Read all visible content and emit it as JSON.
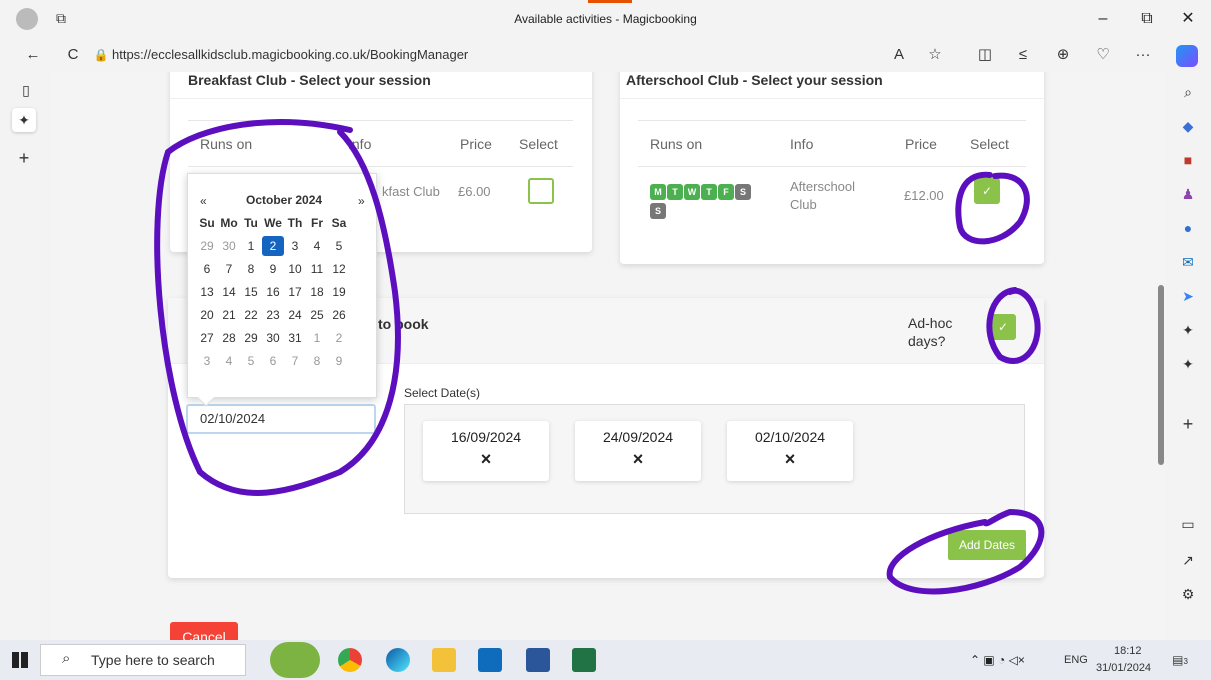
{
  "window": {
    "title": "Available activities - Magicbooking",
    "minimize": "–",
    "maximize": "⧉",
    "close": "✕"
  },
  "browser": {
    "url": "https://ecclesallkidsclub.magicbooking.co.uk/BookingManager",
    "back": "←",
    "refresh": "C",
    "read_aloud": "A",
    "more": "···"
  },
  "breakfast": {
    "title": "Breakfast Club - Select your session",
    "headers": {
      "runs_on": "Runs on",
      "info": "Info",
      "price": "Price",
      "select": "Select"
    },
    "row": {
      "info": "kfast Club",
      "price": "£6.00"
    }
  },
  "afterschool": {
    "title": "Afterschool Club - Select your session",
    "headers": {
      "runs_on": "Runs on",
      "info": "Info",
      "price": "Price",
      "select": "Select"
    },
    "days": [
      "M",
      "T",
      "W",
      "T",
      "F",
      "S",
      "S"
    ],
    "row": {
      "info": "Afterschool Club",
      "price": "£12.00",
      "check": "✓"
    }
  },
  "dates_card": {
    "title_fragment": "to book",
    "adhoc_label": "Ad-hoc days?",
    "adhoc_check": "✓",
    "select_dates_label": "Select Date(s)",
    "date_input_value": "02/10/2024",
    "selected_dates": [
      {
        "date": "16/09/2024",
        "remove": "×"
      },
      {
        "date": "24/09/2024",
        "remove": "×"
      },
      {
        "date": "02/10/2024",
        "remove": "×"
      }
    ],
    "add_dates_button": "Add Dates",
    "cancel_button": "Cancel"
  },
  "calendar": {
    "prev": "«",
    "month": "October 2024",
    "next": "»",
    "weekdays": [
      "Su",
      "Mo",
      "Tu",
      "We",
      "Th",
      "Fr",
      "Sa"
    ],
    "weeks": [
      [
        "29",
        "30",
        "1",
        "2",
        "3",
        "4",
        "5"
      ],
      [
        "6",
        "7",
        "8",
        "9",
        "10",
        "11",
        "12"
      ],
      [
        "13",
        "14",
        "15",
        "16",
        "17",
        "18",
        "19"
      ],
      [
        "20",
        "21",
        "22",
        "23",
        "24",
        "25",
        "26"
      ],
      [
        "27",
        "28",
        "29",
        "30",
        "31",
        "1",
        "2"
      ],
      [
        "3",
        "4",
        "5",
        "6",
        "7",
        "8",
        "9"
      ]
    ],
    "selected": "2"
  },
  "taskbar": {
    "search_placeholder": "Type here to search",
    "time": "18:12",
    "date": "31/01/2024",
    "lang": "ENG",
    "notif_count": "3"
  },
  "colors": {
    "accent_green": "#8bc34a",
    "annotation_purple": "#5b0fbf",
    "cancel_red": "#f44336",
    "calendar_selected": "#1565c0"
  }
}
